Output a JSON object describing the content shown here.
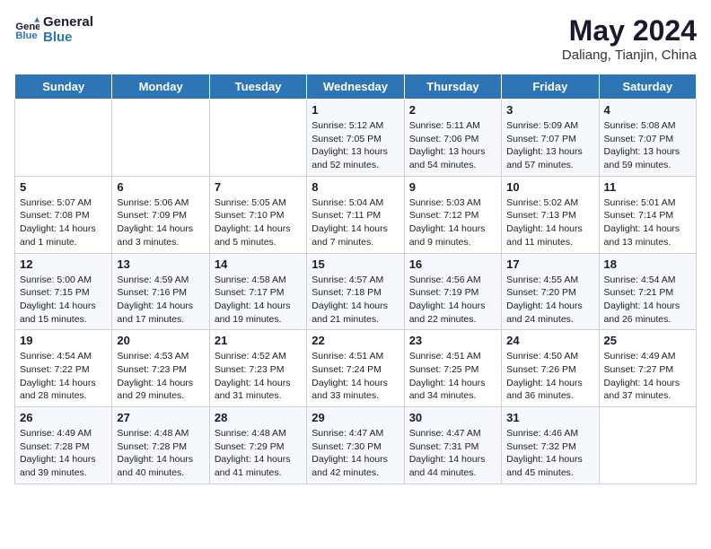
{
  "logo": {
    "line1": "General",
    "line2": "Blue"
  },
  "title": "May 2024",
  "location": "Daliang, Tianjin, China",
  "days_of_week": [
    "Sunday",
    "Monday",
    "Tuesday",
    "Wednesday",
    "Thursday",
    "Friday",
    "Saturday"
  ],
  "weeks": [
    [
      {
        "num": "",
        "info": ""
      },
      {
        "num": "",
        "info": ""
      },
      {
        "num": "",
        "info": ""
      },
      {
        "num": "1",
        "info": "Sunrise: 5:12 AM\nSunset: 7:05 PM\nDaylight: 13 hours and 52 minutes."
      },
      {
        "num": "2",
        "info": "Sunrise: 5:11 AM\nSunset: 7:06 PM\nDaylight: 13 hours and 54 minutes."
      },
      {
        "num": "3",
        "info": "Sunrise: 5:09 AM\nSunset: 7:07 PM\nDaylight: 13 hours and 57 minutes."
      },
      {
        "num": "4",
        "info": "Sunrise: 5:08 AM\nSunset: 7:07 PM\nDaylight: 13 hours and 59 minutes."
      }
    ],
    [
      {
        "num": "5",
        "info": "Sunrise: 5:07 AM\nSunset: 7:08 PM\nDaylight: 14 hours and 1 minute."
      },
      {
        "num": "6",
        "info": "Sunrise: 5:06 AM\nSunset: 7:09 PM\nDaylight: 14 hours and 3 minutes."
      },
      {
        "num": "7",
        "info": "Sunrise: 5:05 AM\nSunset: 7:10 PM\nDaylight: 14 hours and 5 minutes."
      },
      {
        "num": "8",
        "info": "Sunrise: 5:04 AM\nSunset: 7:11 PM\nDaylight: 14 hours and 7 minutes."
      },
      {
        "num": "9",
        "info": "Sunrise: 5:03 AM\nSunset: 7:12 PM\nDaylight: 14 hours and 9 minutes."
      },
      {
        "num": "10",
        "info": "Sunrise: 5:02 AM\nSunset: 7:13 PM\nDaylight: 14 hours and 11 minutes."
      },
      {
        "num": "11",
        "info": "Sunrise: 5:01 AM\nSunset: 7:14 PM\nDaylight: 14 hours and 13 minutes."
      }
    ],
    [
      {
        "num": "12",
        "info": "Sunrise: 5:00 AM\nSunset: 7:15 PM\nDaylight: 14 hours and 15 minutes."
      },
      {
        "num": "13",
        "info": "Sunrise: 4:59 AM\nSunset: 7:16 PM\nDaylight: 14 hours and 17 minutes."
      },
      {
        "num": "14",
        "info": "Sunrise: 4:58 AM\nSunset: 7:17 PM\nDaylight: 14 hours and 19 minutes."
      },
      {
        "num": "15",
        "info": "Sunrise: 4:57 AM\nSunset: 7:18 PM\nDaylight: 14 hours and 21 minutes."
      },
      {
        "num": "16",
        "info": "Sunrise: 4:56 AM\nSunset: 7:19 PM\nDaylight: 14 hours and 22 minutes."
      },
      {
        "num": "17",
        "info": "Sunrise: 4:55 AM\nSunset: 7:20 PM\nDaylight: 14 hours and 24 minutes."
      },
      {
        "num": "18",
        "info": "Sunrise: 4:54 AM\nSunset: 7:21 PM\nDaylight: 14 hours and 26 minutes."
      }
    ],
    [
      {
        "num": "19",
        "info": "Sunrise: 4:54 AM\nSunset: 7:22 PM\nDaylight: 14 hours and 28 minutes."
      },
      {
        "num": "20",
        "info": "Sunrise: 4:53 AM\nSunset: 7:23 PM\nDaylight: 14 hours and 29 minutes."
      },
      {
        "num": "21",
        "info": "Sunrise: 4:52 AM\nSunset: 7:23 PM\nDaylight: 14 hours and 31 minutes."
      },
      {
        "num": "22",
        "info": "Sunrise: 4:51 AM\nSunset: 7:24 PM\nDaylight: 14 hours and 33 minutes."
      },
      {
        "num": "23",
        "info": "Sunrise: 4:51 AM\nSunset: 7:25 PM\nDaylight: 14 hours and 34 minutes."
      },
      {
        "num": "24",
        "info": "Sunrise: 4:50 AM\nSunset: 7:26 PM\nDaylight: 14 hours and 36 minutes."
      },
      {
        "num": "25",
        "info": "Sunrise: 4:49 AM\nSunset: 7:27 PM\nDaylight: 14 hours and 37 minutes."
      }
    ],
    [
      {
        "num": "26",
        "info": "Sunrise: 4:49 AM\nSunset: 7:28 PM\nDaylight: 14 hours and 39 minutes."
      },
      {
        "num": "27",
        "info": "Sunrise: 4:48 AM\nSunset: 7:28 PM\nDaylight: 14 hours and 40 minutes."
      },
      {
        "num": "28",
        "info": "Sunrise: 4:48 AM\nSunset: 7:29 PM\nDaylight: 14 hours and 41 minutes."
      },
      {
        "num": "29",
        "info": "Sunrise: 4:47 AM\nSunset: 7:30 PM\nDaylight: 14 hours and 42 minutes."
      },
      {
        "num": "30",
        "info": "Sunrise: 4:47 AM\nSunset: 7:31 PM\nDaylight: 14 hours and 44 minutes."
      },
      {
        "num": "31",
        "info": "Sunrise: 4:46 AM\nSunset: 7:32 PM\nDaylight: 14 hours and 45 minutes."
      },
      {
        "num": "",
        "info": ""
      }
    ]
  ]
}
